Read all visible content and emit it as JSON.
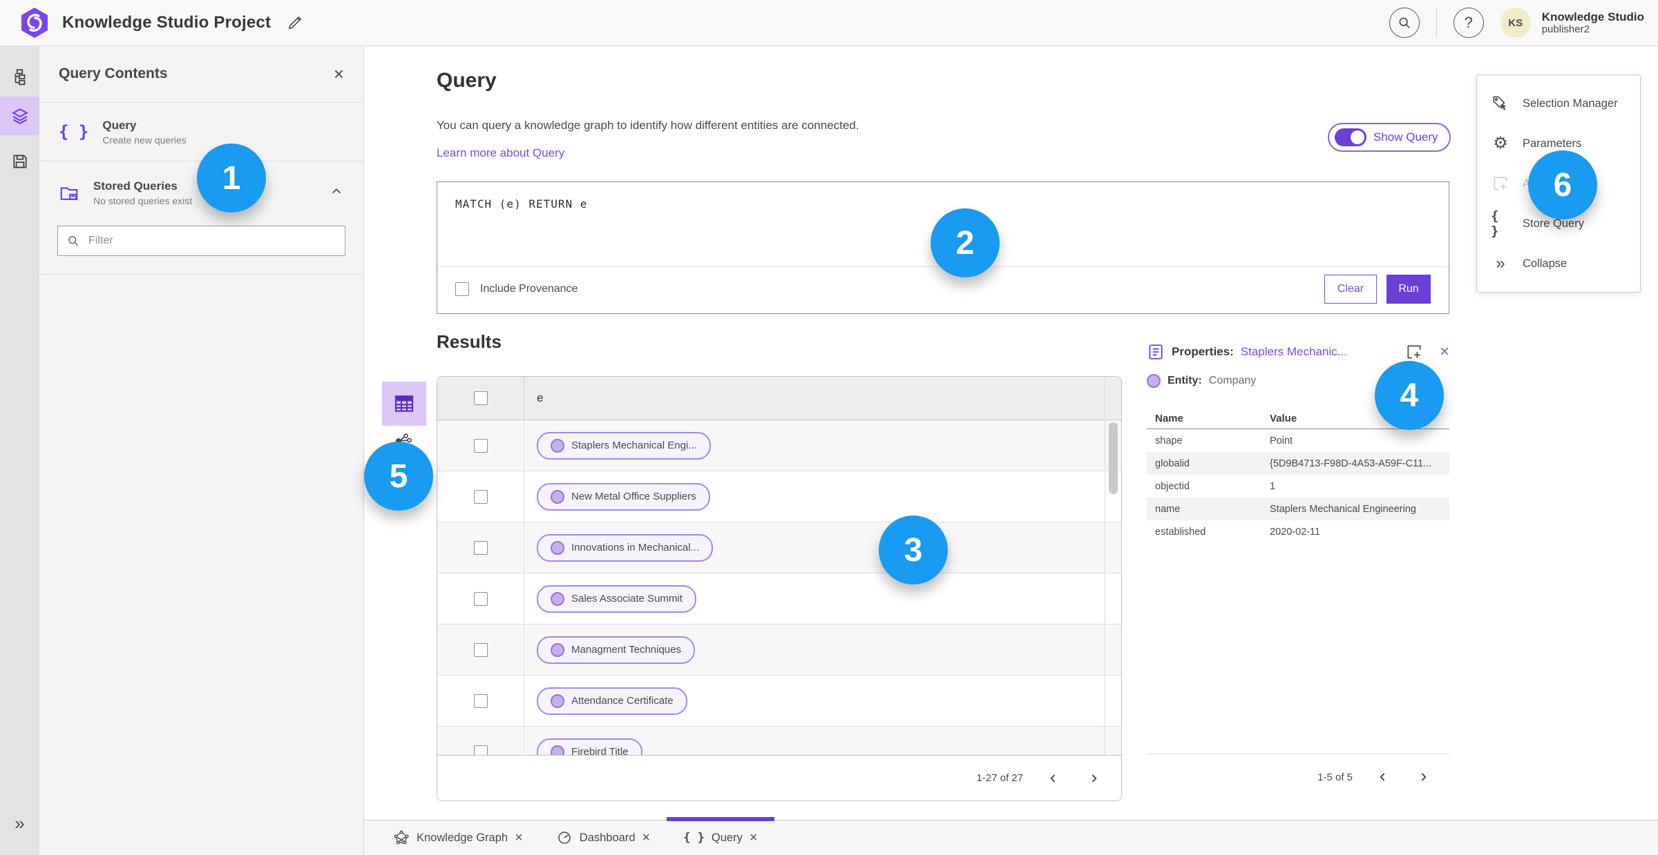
{
  "topbar": {
    "title": "Knowledge Studio Project",
    "user_name": "Knowledge Studio",
    "user_role": "publisher2",
    "avatar_initials": "KS",
    "help_glyph": "?"
  },
  "left_panel": {
    "title": "Query Contents",
    "close_glyph": "×",
    "query_item": {
      "icon_glyph": "{ }",
      "title": "Query",
      "subtitle": "Create new queries"
    },
    "stored_item": {
      "title": "Stored Queries",
      "subtitle": "No stored queries exist"
    },
    "filter_placeholder": "Filter"
  },
  "query": {
    "heading": "Query",
    "description": "You can query a knowledge graph to identify how different entities are connected.",
    "learn_more": "Learn more about Query",
    "show_query": "Show Query",
    "text": "MATCH (e) RETURN e",
    "include_provenance": "Include Provenance",
    "clear": "Clear",
    "run": "Run"
  },
  "results": {
    "heading": "Results",
    "column": "e",
    "rows": [
      "Staplers Mechanical Engi...",
      "New Metal Office Suppliers",
      "Innovations in Mechanical...",
      "Sales Associate Summit",
      "Managment Techniques",
      "Attendance Certificate",
      "Firebird Title"
    ],
    "pagination": "1-27 of 27"
  },
  "properties": {
    "label": "Properties:",
    "entity_link": "Staplers Mechanic...",
    "close_glyph": "×",
    "entity_label": "Entity:",
    "entity_value": "Company",
    "col_name": "Name",
    "col_value": "Value",
    "rows": [
      [
        "shape",
        "Point"
      ],
      [
        "globalid",
        "{5D9B4713-F98D-4A53-A59F-C11..."
      ],
      [
        "objectid",
        "1"
      ],
      [
        "name",
        "Staplers Mechanical Engineering"
      ],
      [
        "established",
        "2020-02-11"
      ]
    ],
    "pagination": "1-5 of 5"
  },
  "right_menu": {
    "gear_glyph": "⚙",
    "braces_glyph": "{ }",
    "collapse_glyph": "»",
    "items": [
      {
        "label": "Selection Manager"
      },
      {
        "label": "Parameters"
      },
      {
        "label": "Ad"
      },
      {
        "label": "Store Query"
      },
      {
        "label": "Collapse"
      }
    ]
  },
  "tabs": {
    "close_glyph": "×",
    "items": [
      {
        "label": "Knowledge Graph"
      },
      {
        "label": "Dashboard"
      },
      {
        "label": "Query"
      }
    ]
  },
  "rail": {
    "expand_glyph": "»"
  },
  "badges": [
    "1",
    "2",
    "3",
    "4",
    "5",
    "6"
  ],
  "colors": {
    "accent_purple": "#6b3fd8",
    "badge_blue": "#189bf0",
    "link_purple": "#7a4bd8",
    "selected_lavender": "#dcc7f8"
  }
}
